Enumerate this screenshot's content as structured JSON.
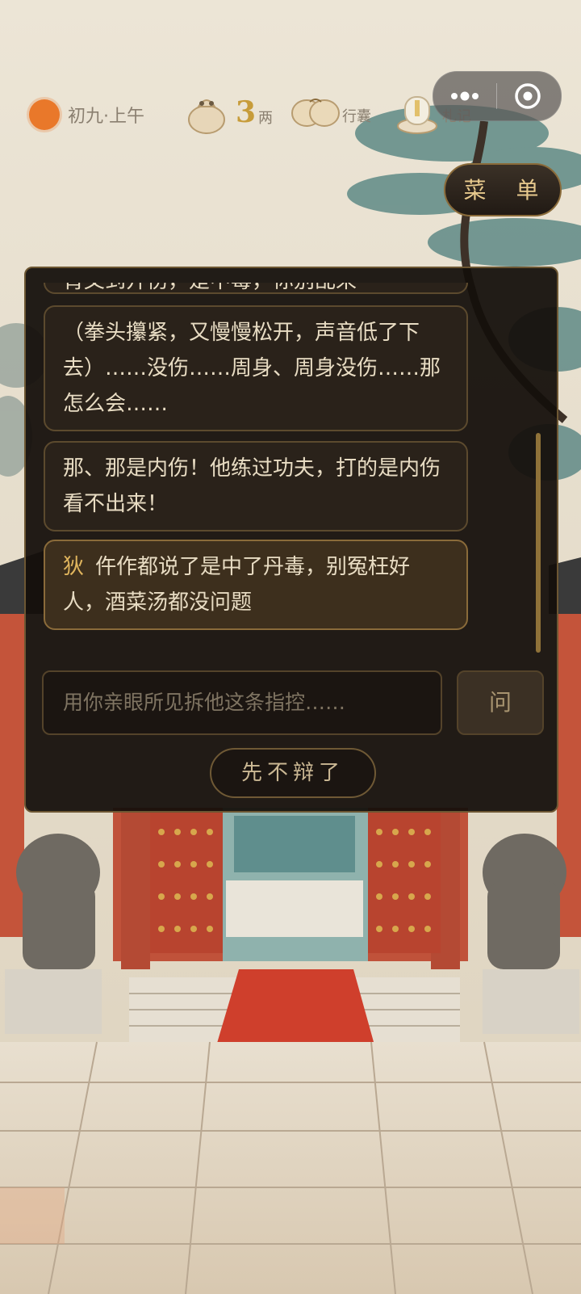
{
  "status": {
    "date_time": "初九·上午",
    "money_amount": "3",
    "money_unit": "两",
    "bag_label": "行囊",
    "notes_label": "札记"
  },
  "capsule": {
    "more_icon": "more-dots-icon",
    "close_icon": "target-close-icon"
  },
  "menu": {
    "label": "菜 单"
  },
  "dialog": {
    "messages": [
      {
        "speaker": "",
        "text": "肯叉到开伤，是中毒，你别乱来"
      },
      {
        "speaker": "",
        "text": "（拳头攥紧，又慢慢松开，声音低了下去）……没伤……周身、周身没伤……那怎么会……"
      },
      {
        "speaker": "",
        "text": "那、那是内伤！他练过功夫，打的是内伤看不出来！"
      },
      {
        "speaker": "狄",
        "text": "仵作都说了是中了丹毒，别冤枉好人，酒菜汤都没问题"
      }
    ],
    "input_placeholder": "用你亲眼所见拆他这条指控……",
    "ask_label": "问",
    "giveup_label": "先不辩了"
  },
  "colors": {
    "accent": "#e0b55d",
    "panel_bg": "#140f0b",
    "gold_border": "#8a6b3a",
    "sun": "#e9782a"
  }
}
